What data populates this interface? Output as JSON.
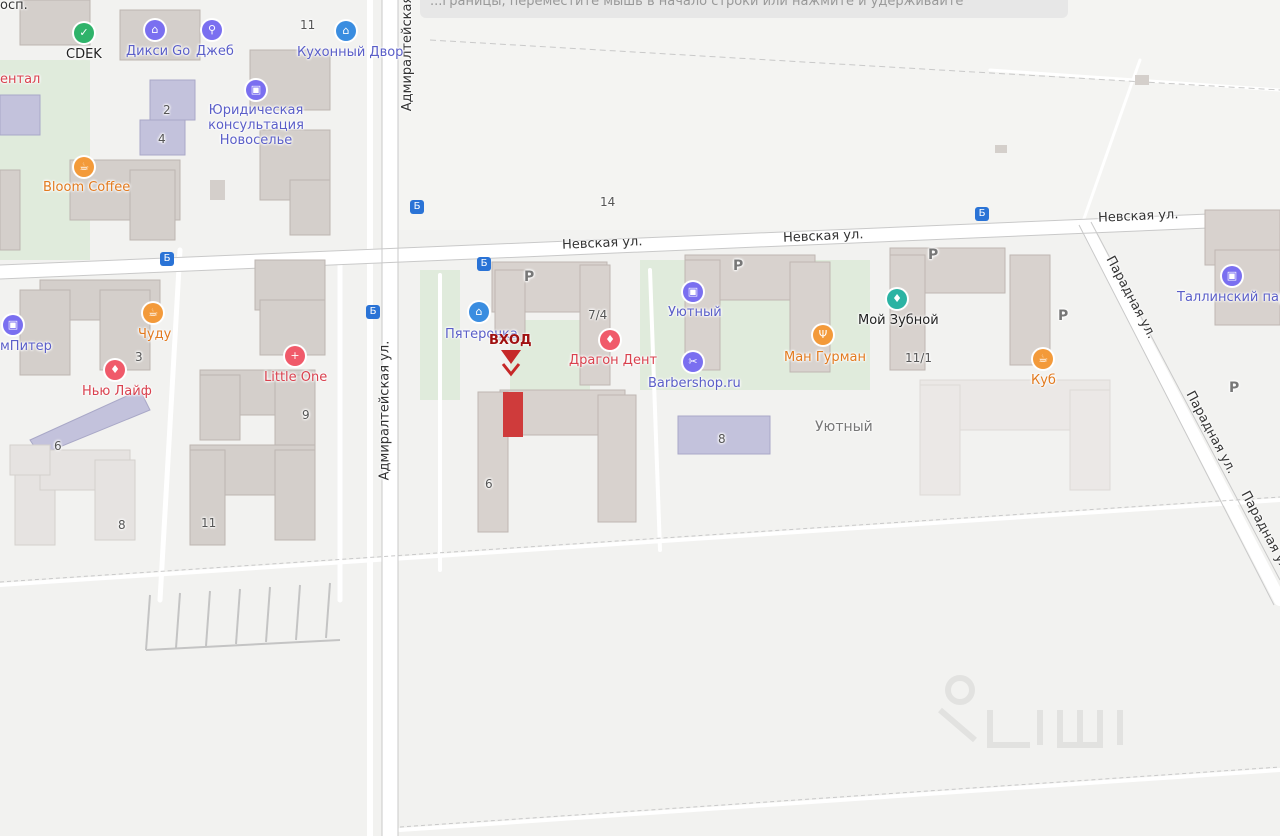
{
  "banner": {
    "text": "...границы, переместите мышь в начало строки или нажмите и удерживайте"
  },
  "streets": {
    "nevskaya_1": "Невская ул.",
    "nevskaya_2": "Невская ул.",
    "nevskaya_3": "Невская ул.",
    "admiralteyskaya_1": "Адмиралтейская",
    "admiralteyskaya_2": "Адмиралтейская ул.",
    "paradnaya_1": "Парадная ул.",
    "paradnaya_2": "Парадная ул.",
    "paradnaya_3": "Парадная ул.",
    "prosp": "осп."
  },
  "pois": {
    "cdek": "CDEK",
    "diksi": "Дикси Go",
    "dzheb": "Джеб",
    "kuhonny": "Кухонный Двор",
    "dental": "ентал",
    "yurid": "Юридическая консультация Новоселье",
    "bloom": "Bloom Coffee",
    "chudu": "Чуду",
    "mpiter": "мПитер",
    "nyulaif": "Нью Лайф",
    "littleone": "Little One",
    "pyaterochka": "Пятерочка",
    "dragon": "Драгон Дент",
    "uyutny_shop": "Уютный",
    "barbershop": "Barbershop.ru",
    "mangurman": "Ман Гурман",
    "zubnoy": "Мой Зубной",
    "kub": "Куб",
    "tallinn": "Таллинский пар",
    "uyutny_area": "Уютный"
  },
  "entrance": "ВХОД",
  "house_numbers": {
    "n11a": "11",
    "n2": "2",
    "n4": "4",
    "n14": "14",
    "n7_4": "7/4",
    "n3": "3",
    "n9": "9",
    "n6a": "6",
    "n8a": "8",
    "n11b": "11",
    "n6b": "6",
    "n8b": "8",
    "n11_1": "11/1"
  },
  "parking_label": "P",
  "icons": {
    "shop": "basket-icon",
    "service": "briefcase-icon",
    "food": "coffee-icon",
    "medical": "tooth-icon",
    "clinic": "cross-icon",
    "barber": "scissors-icon",
    "restaurant": "fork-knife-icon",
    "fitness": "dumbbell-icon",
    "delivery": "delivery-icon",
    "bus": "bus-stop-icon"
  },
  "colors": {
    "poi": "#5a5ec8",
    "food": "#e27a1f",
    "medical": "#d9414e",
    "entrance": "#c62828",
    "building": "#cfcac6"
  }
}
